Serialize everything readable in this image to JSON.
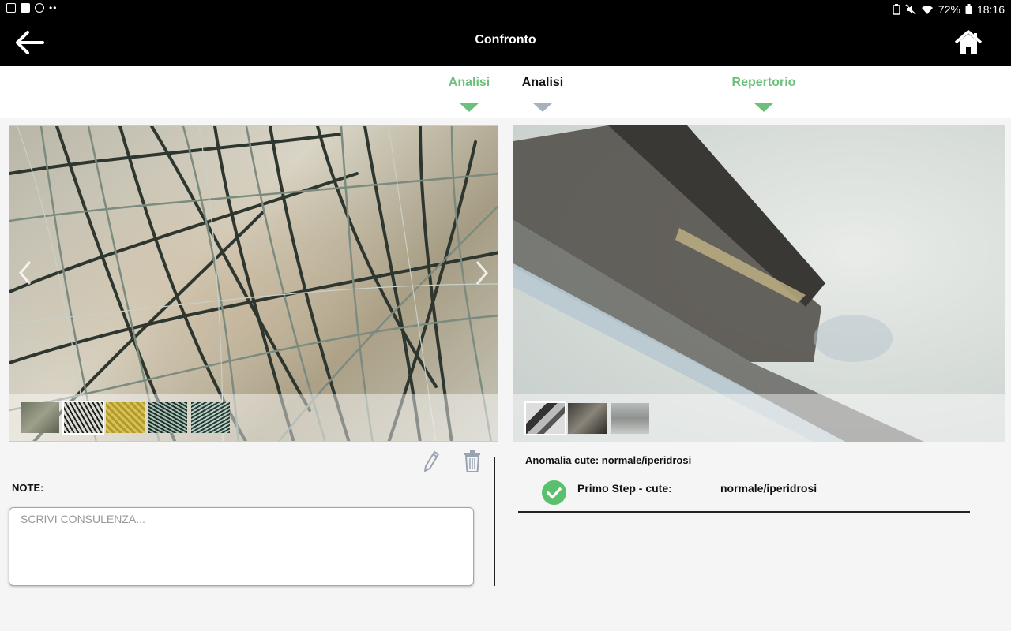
{
  "status_bar": {
    "left_icons": [
      "gallery-icon",
      "flipboard-icon",
      "sync-icon"
    ],
    "more": "••",
    "battery_percent": "72%",
    "time": "18:16"
  },
  "app_bar": {
    "title": "Confronto",
    "back_icon": "arrow-left-icon",
    "home_icon": "home-icon"
  },
  "tabs": [
    {
      "label": "Analisi",
      "state": "green"
    },
    {
      "label": "Analisi",
      "state": "selected"
    },
    {
      "label": "Repertorio",
      "state": "green"
    }
  ],
  "colors": {
    "accent_green": "#6cc17a",
    "check_green": "#5bc06d",
    "tab_marker_grey": "#a9b1c1",
    "appbar_bg": "#000000"
  },
  "left_panel": {
    "image": "hair-microscope-image",
    "thumbnail_count": 5,
    "selected_thumbnail": 2
  },
  "right_panel": {
    "image": "hair-closeup-microscope-image",
    "thumbnail_count": 3,
    "selected_thumbnail": 1
  },
  "notes": {
    "label": "NOTE:",
    "placeholder": "SCRIVI CONSULENZA..."
  },
  "result": {
    "anomaly": "Anomalia cute: normale/iperidrosi",
    "step_label": "Primo Step - cute:",
    "step_value": "normale/iperidrosi"
  }
}
